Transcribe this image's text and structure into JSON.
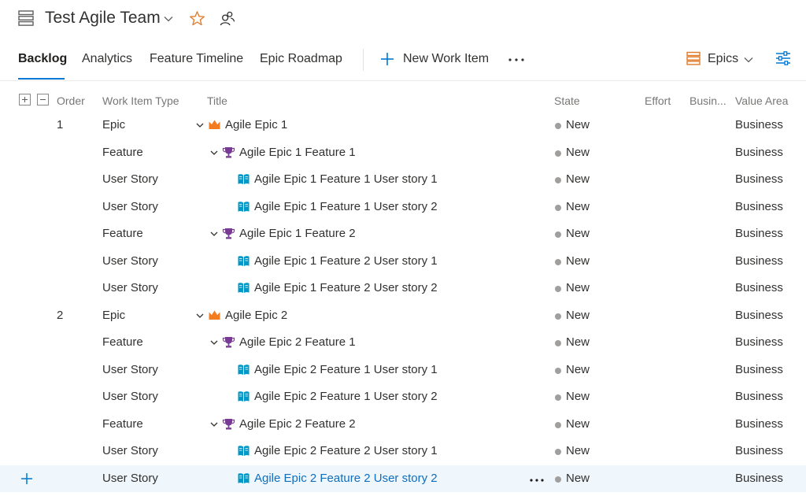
{
  "header": {
    "team_name": "Test Agile Team",
    "icons": [
      "backlog-team-icon",
      "chevron-down-icon",
      "star-icon",
      "team-members-icon"
    ],
    "colors": {
      "star": "#e07b28"
    }
  },
  "tabs": [
    {
      "label": "Backlog",
      "active": true
    },
    {
      "label": "Analytics",
      "active": false
    },
    {
      "label": "Feature Timeline",
      "active": false
    },
    {
      "label": "Epic Roadmap",
      "active": false
    }
  ],
  "toolbar": {
    "new_work_item_label": "New Work Item",
    "level_selector_label": "Epics",
    "icons": [
      "plus-icon",
      "more-icon",
      "epics-level-icon",
      "view-options-icon"
    ]
  },
  "columns": {
    "order": "Order",
    "work_item_type": "Work Item Type",
    "title": "Title",
    "state": "State",
    "effort": "Effort",
    "business": "Busin...",
    "value_area": "Value Area"
  },
  "colors": {
    "accent": "#0078d4",
    "epic_icon": "#f47c20",
    "feature_icon": "#773b93",
    "story_icon": "#0098c7",
    "state_new": "#a19f9d",
    "selected_row": "#eff6fc"
  },
  "rows": [
    {
      "order": "1",
      "type": "Epic",
      "title": "Agile Epic 1",
      "state": "New",
      "value_area": "Business",
      "level": 0,
      "kind": "epic",
      "expandable": true
    },
    {
      "order": "",
      "type": "Feature",
      "title": "Agile Epic 1 Feature 1",
      "state": "New",
      "value_area": "Business",
      "level": 1,
      "kind": "feature",
      "expandable": true
    },
    {
      "order": "",
      "type": "User Story",
      "title": "Agile Epic 1 Feature 1 User story 1",
      "state": "New",
      "value_area": "Business",
      "level": 2,
      "kind": "story",
      "expandable": false
    },
    {
      "order": "",
      "type": "User Story",
      "title": "Agile Epic 1 Feature 1 User story 2",
      "state": "New",
      "value_area": "Business",
      "level": 2,
      "kind": "story",
      "expandable": false
    },
    {
      "order": "",
      "type": "Feature",
      "title": "Agile Epic 1 Feature 2",
      "state": "New",
      "value_area": "Business",
      "level": 1,
      "kind": "feature",
      "expandable": true
    },
    {
      "order": "",
      "type": "User Story",
      "title": "Agile Epic 1 Feature 2 User story 1",
      "state": "New",
      "value_area": "Business",
      "level": 2,
      "kind": "story",
      "expandable": false
    },
    {
      "order": "",
      "type": "User Story",
      "title": "Agile Epic 1 Feature 2 User story 2",
      "state": "New",
      "value_area": "Business",
      "level": 2,
      "kind": "story",
      "expandable": false
    },
    {
      "order": "2",
      "type": "Epic",
      "title": "Agile Epic 2",
      "state": "New",
      "value_area": "Business",
      "level": 0,
      "kind": "epic",
      "expandable": true
    },
    {
      "order": "",
      "type": "Feature",
      "title": "Agile Epic 2 Feature 1",
      "state": "New",
      "value_area": "Business",
      "level": 1,
      "kind": "feature",
      "expandable": true
    },
    {
      "order": "",
      "type": "User Story",
      "title": "Agile Epic 2 Feature 1 User story 1",
      "state": "New",
      "value_area": "Business",
      "level": 2,
      "kind": "story",
      "expandable": false
    },
    {
      "order": "",
      "type": "User Story",
      "title": "Agile Epic 2 Feature 1 User story 2",
      "state": "New",
      "value_area": "Business",
      "level": 2,
      "kind": "story",
      "expandable": false
    },
    {
      "order": "",
      "type": "Feature",
      "title": "Agile Epic 2 Feature 2",
      "state": "New",
      "value_area": "Business",
      "level": 1,
      "kind": "feature",
      "expandable": true
    },
    {
      "order": "",
      "type": "User Story",
      "title": "Agile Epic 2 Feature 2 User story 1",
      "state": "New",
      "value_area": "Business",
      "level": 2,
      "kind": "story",
      "expandable": false
    },
    {
      "order": "",
      "type": "User Story",
      "title": "Agile Epic 2 Feature 2 User story 2",
      "state": "New",
      "value_area": "Business",
      "level": 2,
      "kind": "story",
      "expandable": false,
      "selected": true
    }
  ]
}
